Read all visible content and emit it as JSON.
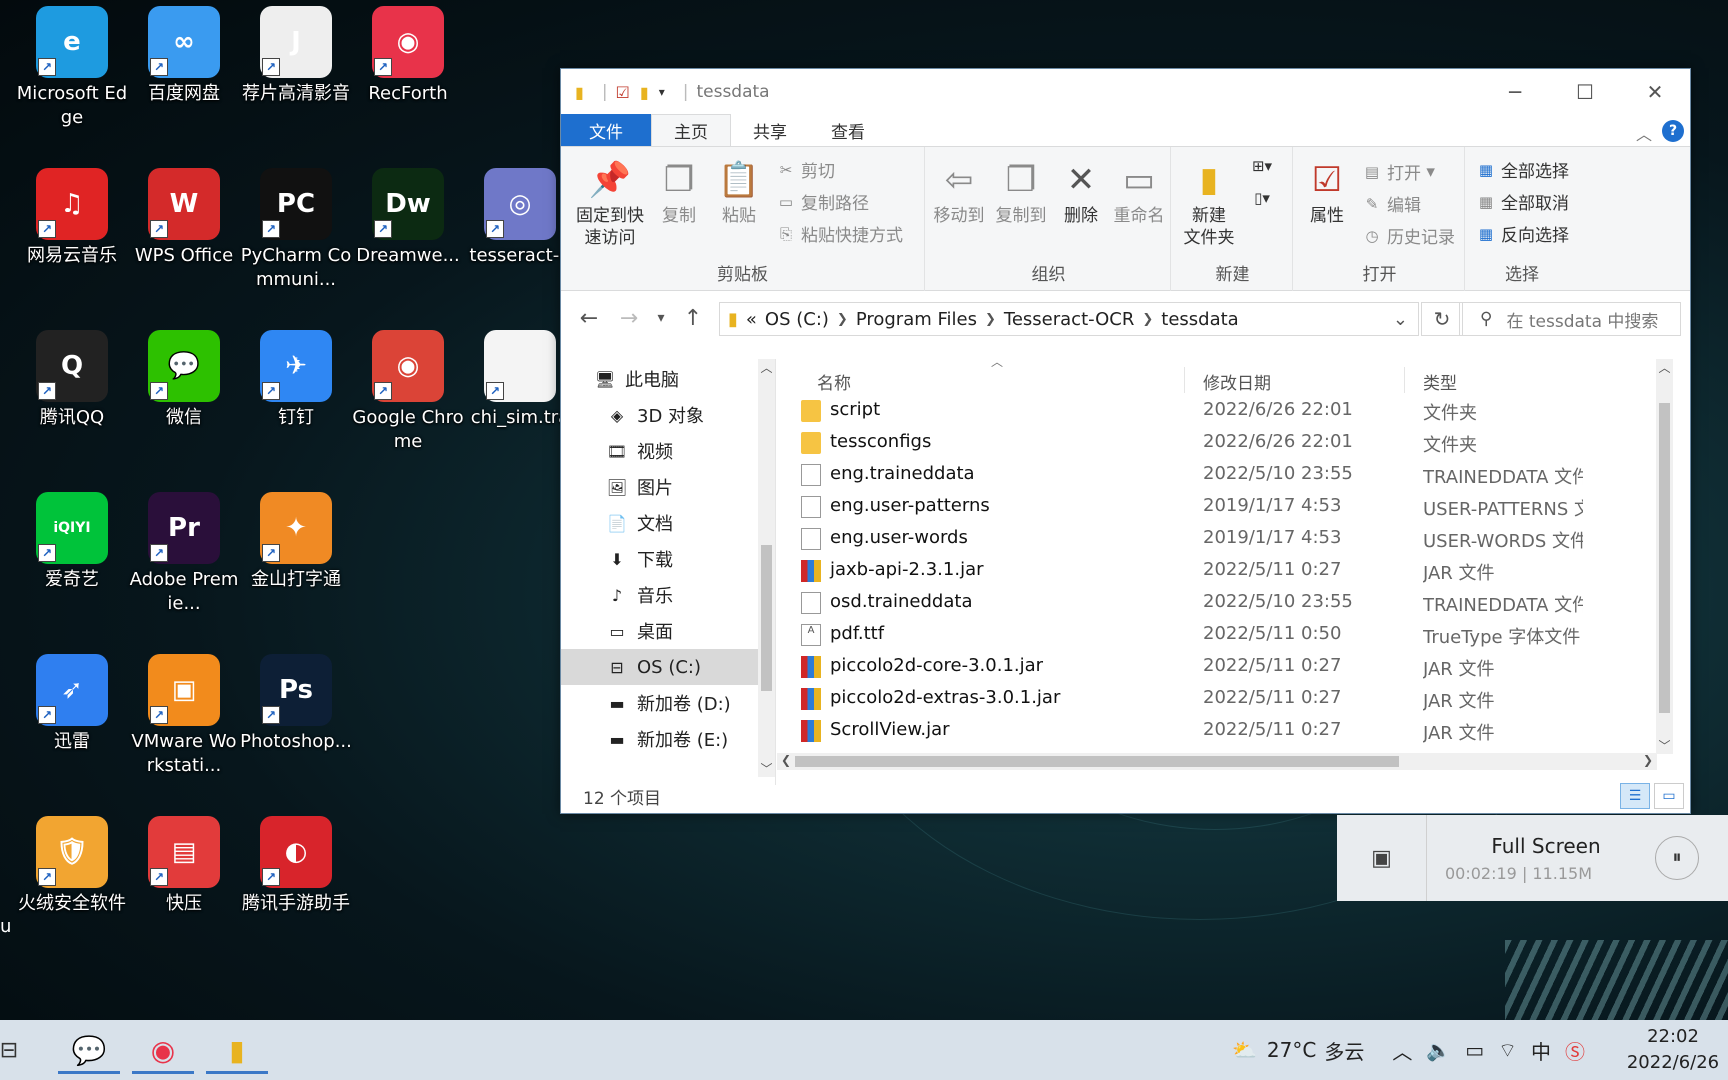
{
  "desktop": {
    "icons": [
      {
        "label": "Microsoft Edge",
        "icon": "edge-icon",
        "color": "#1e9be0",
        "glyph": "e"
      },
      {
        "label": "百度网盘",
        "icon": "baidu-netdisk-icon",
        "color": "#3a9bf0",
        "glyph": "∞"
      },
      {
        "label": "荐片高清影音",
        "icon": "jianpian-icon",
        "color": "#eeeeee",
        "glyph": "J"
      },
      {
        "label": "RecForth",
        "icon": "recforth-icon",
        "color": "#e8334a",
        "glyph": "◉"
      },
      {
        "label": "网易云音乐",
        "icon": "netease-music-icon",
        "color": "#e02424",
        "glyph": "♫"
      },
      {
        "label": "WPS Office",
        "icon": "wps-icon",
        "color": "#d42a2a",
        "glyph": "W"
      },
      {
        "label": "PyCharm Communi...",
        "icon": "pycharm-icon",
        "color": "#111111",
        "glyph": "PC"
      },
      {
        "label": "Dreamwe...",
        "icon": "dreamweaver-icon",
        "color": "#0c2a12",
        "glyph": "Dw"
      },
      {
        "label": "tesseract-o",
        "icon": "tesseract-installer-icon",
        "color": "#6f78c8",
        "glyph": "◎"
      },
      {
        "label": "腾讯QQ",
        "icon": "qq-icon",
        "color": "#222222",
        "glyph": "Q"
      },
      {
        "label": "微信",
        "icon": "wechat-icon",
        "color": "#2dc100",
        "glyph": "💬"
      },
      {
        "label": "钉钉",
        "icon": "dingtalk-icon",
        "color": "#2f87f3",
        "glyph": "✈"
      },
      {
        "label": "Google Chrome",
        "icon": "chrome-icon",
        "color": "#db4437",
        "glyph": "◉"
      },
      {
        "label": "chi_sim.tra",
        "icon": "file-icon",
        "color": "#f4f4f4",
        "glyph": ""
      },
      {
        "label": "爱奇艺",
        "icon": "iqiyi-icon",
        "color": "#00c33a",
        "glyph": "iQIYI"
      },
      {
        "label": "Adobe Premie...",
        "icon": "premiere-icon",
        "color": "#2a0f3a",
        "glyph": "Pr"
      },
      {
        "label": "金山打字通",
        "icon": "jinshan-typing-icon",
        "color": "#f08a24",
        "glyph": "✦"
      },
      {
        "label": "迅雷",
        "icon": "xunlei-icon",
        "color": "#2f7ff0",
        "glyph": "➶"
      },
      {
        "label": "VMware Workstati...",
        "icon": "vmware-icon",
        "color": "#f28b1c",
        "glyph": "▣"
      },
      {
        "label": "Photoshop...",
        "icon": "photoshop-icon",
        "color": "#0d1f36",
        "glyph": "Ps"
      },
      {
        "label": "火绒安全软件",
        "icon": "huorong-icon",
        "color": "#f2a531",
        "glyph": "🛡"
      },
      {
        "label": "快压",
        "icon": "kuaiya-icon",
        "color": "#e23b3b",
        "glyph": "▤"
      },
      {
        "label": "腾讯手游助手",
        "icon": "tencent-game-assistant-icon",
        "color": "#d8242b",
        "glyph": "◐"
      }
    ],
    "stray_label": "u"
  },
  "explorer": {
    "title": "tessdata",
    "tabs": {
      "file": "文件",
      "home": "主页",
      "share": "共享",
      "view": "查看"
    },
    "ribbon": {
      "clipboard": {
        "group": "剪贴板",
        "pin": "固定到快\n速访问",
        "copy": "复制",
        "paste": "粘贴",
        "cut": "剪切",
        "copy_path": "复制路径",
        "paste_shortcut": "粘贴快捷方式"
      },
      "organize": {
        "group": "组织",
        "move_to": "移动到",
        "copy_to": "复制到",
        "delete": "删除",
        "rename": "重命名"
      },
      "new": {
        "group": "新建",
        "new_folder": "新建\n文件夹"
      },
      "open": {
        "group": "打开",
        "properties": "属性",
        "open": "打开",
        "edit": "编辑",
        "history": "历史记录"
      },
      "select": {
        "group": "选择",
        "select_all": "全部选择",
        "select_none": "全部取消",
        "invert": "反向选择"
      }
    },
    "address": {
      "prefix": "«",
      "crumbs": [
        "OS (C:)",
        "Program Files",
        "Tesseract-OCR",
        "tessdata"
      ]
    },
    "search_placeholder": "在 tessdata 中搜索",
    "nav_items": [
      {
        "label": "此电脑",
        "icon": "this-pc-icon",
        "glyph": "🖥",
        "indent": 0
      },
      {
        "label": "3D 对象",
        "icon": "3d-objects-icon",
        "glyph": "◈",
        "indent": 1
      },
      {
        "label": "视频",
        "icon": "videos-icon",
        "glyph": "🎞",
        "indent": 1
      },
      {
        "label": "图片",
        "icon": "pictures-icon",
        "glyph": "🖼",
        "indent": 1
      },
      {
        "label": "文档",
        "icon": "documents-icon",
        "glyph": "📄",
        "indent": 1
      },
      {
        "label": "下载",
        "icon": "downloads-icon",
        "glyph": "⬇",
        "indent": 1
      },
      {
        "label": "音乐",
        "icon": "music-icon",
        "glyph": "♪",
        "indent": 1
      },
      {
        "label": "桌面",
        "icon": "desktop-icon",
        "glyph": "▭",
        "indent": 1
      },
      {
        "label": "OS (C:)",
        "icon": "drive-c-icon",
        "glyph": "⊟",
        "indent": 1,
        "selected": true
      },
      {
        "label": "新加卷 (D:)",
        "icon": "drive-d-icon",
        "glyph": "▬",
        "indent": 1
      },
      {
        "label": "新加卷 (E:)",
        "icon": "drive-e-icon",
        "glyph": "▬",
        "indent": 1
      }
    ],
    "columns": {
      "name": "名称",
      "date": "修改日期",
      "type": "类型"
    },
    "files": [
      {
        "name": "script",
        "date": "2022/6/26 22:01",
        "type": "文件夹",
        "kind": "folder"
      },
      {
        "name": "tessconfigs",
        "date": "2022/6/26 22:01",
        "type": "文件夹",
        "kind": "folder"
      },
      {
        "name": "eng.traineddata",
        "date": "2022/5/10 23:55",
        "type": "TRAINEDDATA 文件",
        "kind": "file"
      },
      {
        "name": "eng.user-patterns",
        "date": "2019/1/17 4:53",
        "type": "USER-PATTERNS 文件",
        "kind": "file"
      },
      {
        "name": "eng.user-words",
        "date": "2019/1/17 4:53",
        "type": "USER-WORDS 文件",
        "kind": "file"
      },
      {
        "name": "jaxb-api-2.3.1.jar",
        "date": "2022/5/11 0:27",
        "type": "JAR 文件",
        "kind": "jar"
      },
      {
        "name": "osd.traineddata",
        "date": "2022/5/10 23:55",
        "type": "TRAINEDDATA 文件",
        "kind": "file"
      },
      {
        "name": "pdf.ttf",
        "date": "2022/5/11 0:50",
        "type": "TrueType 字体文件",
        "kind": "font"
      },
      {
        "name": "piccolo2d-core-3.0.1.jar",
        "date": "2022/5/11 0:27",
        "type": "JAR 文件",
        "kind": "jar"
      },
      {
        "name": "piccolo2d-extras-3.0.1.jar",
        "date": "2022/5/11 0:27",
        "type": "JAR 文件",
        "kind": "jar"
      },
      {
        "name": "ScrollView.jar",
        "date": "2022/5/11 0:27",
        "type": "JAR 文件",
        "kind": "jar"
      }
    ],
    "status": "12 个项目"
  },
  "media": {
    "title": "Full Screen",
    "elapsed": "00:02:19",
    "size": "11.15M"
  },
  "taskbar": {
    "weather_temp": "27°C",
    "weather_desc": "多云",
    "ime": "中",
    "time": "22:02",
    "date": "2022/6/26"
  }
}
